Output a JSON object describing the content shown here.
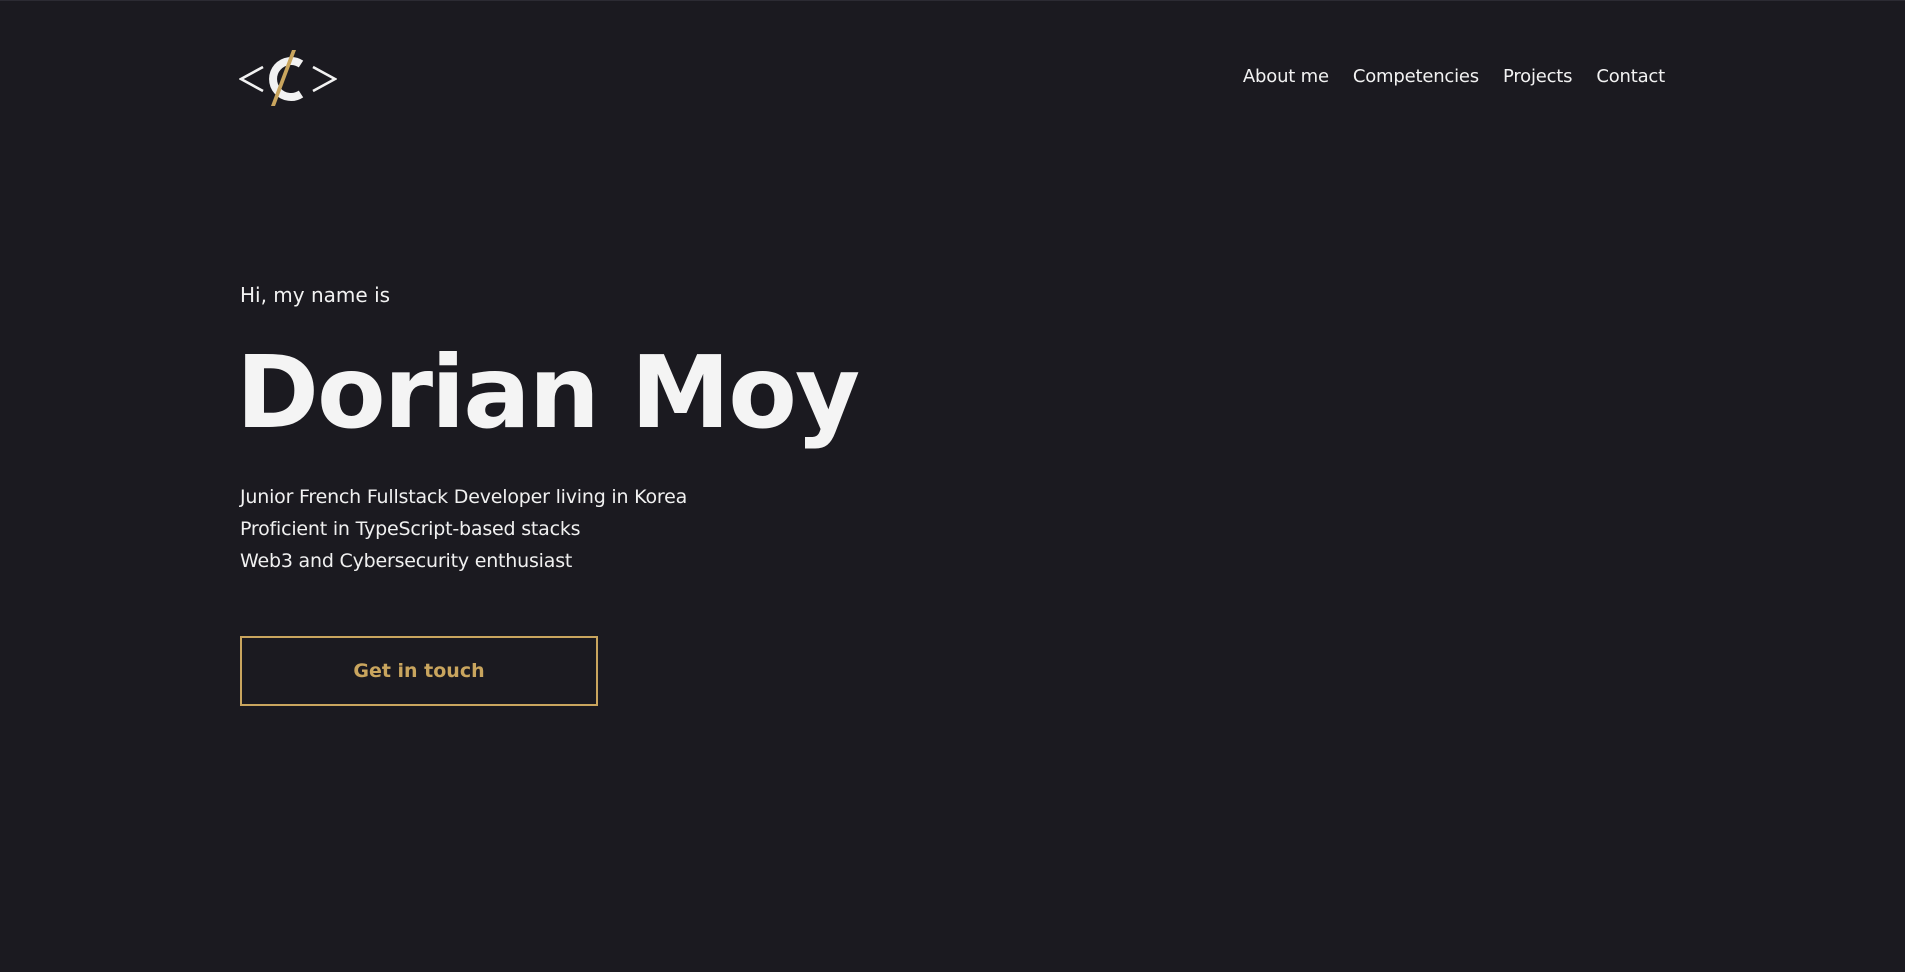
{
  "colors": {
    "background": "#1b1a20",
    "text": "#f2f2f2",
    "accent": "#c9a55e"
  },
  "header": {
    "logo_icon": "code-brackets-c-logo",
    "nav": [
      {
        "label": "About me"
      },
      {
        "label": "Competencies"
      },
      {
        "label": "Projects"
      },
      {
        "label": "Contact"
      }
    ]
  },
  "hero": {
    "greeting": "Hi, my name is",
    "name": "Dorian Moy",
    "bio": [
      "Junior French Fullstack Developer living in Korea",
      "Proficient in TypeScript-based stacks",
      "Web3 and Cybersecurity enthusiast"
    ],
    "cta_label": "Get in touch"
  }
}
